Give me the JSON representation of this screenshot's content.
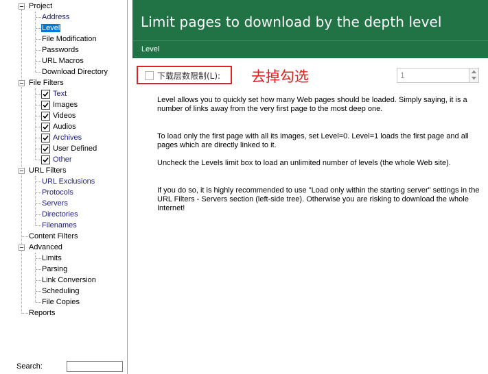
{
  "tree": {
    "project": {
      "label": "Project",
      "children": [
        "Address",
        "Level",
        "File Modification",
        "Passwords",
        "URL Macros",
        "Download Directory"
      ],
      "selected": "Level"
    },
    "file_filters": {
      "label": "File Filters",
      "children": [
        {
          "label": "Text",
          "checked": true
        },
        {
          "label": "Images",
          "checked": true
        },
        {
          "label": "Videos",
          "checked": true
        },
        {
          "label": "Audios",
          "checked": true
        },
        {
          "label": "Archives",
          "checked": true
        },
        {
          "label": "User Defined",
          "checked": true
        },
        {
          "label": "Other",
          "checked": true
        }
      ]
    },
    "url_filters": {
      "label": "URL Filters",
      "children": [
        "URL Exclusions",
        "Protocols",
        "Servers",
        "Directories",
        "Filenames"
      ]
    },
    "content_filters": {
      "label": "Content Filters"
    },
    "advanced": {
      "label": "Advanced",
      "children": [
        "Limits",
        "Parsing",
        "Link Conversion",
        "Scheduling",
        "File Copies"
      ]
    },
    "reports": {
      "label": "Reports"
    }
  },
  "search": {
    "label": "Search:",
    "value": ""
  },
  "header": {
    "title": "Limit pages to download by the depth level",
    "subtitle": "Level",
    "background": "#217346"
  },
  "level_limit": {
    "checkbox_label": "下载层数限制(L):",
    "checked": false,
    "annotation": "去掉勾选",
    "annotation_color": "#e02020",
    "spinner_value": "1"
  },
  "description": [
    "Level allows you to quickly set how many Web pages should be loaded. Simply saying, it is a number of links away from the very first page to the most deep one.",
    "To load only the first page with all its images, set Level=0. Level=1 loads the first page and all pages which are directly linked to it.",
    "Uncheck the Levels limit box to load an unlimited number of levels (the whole Web site).",
    "If you do so, it is highly recommended to use \"Load only within the starting server\" settings in the URL Filters - Servers section (left-side tree). Otherwise you are risking to download the whole Internet!"
  ]
}
